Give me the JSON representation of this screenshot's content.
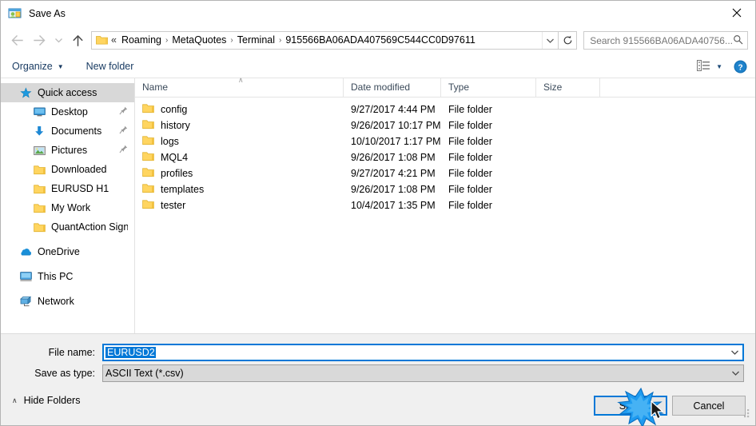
{
  "window": {
    "title": "Save As",
    "title_icon": "save-as-window-icon",
    "close_label": "✕"
  },
  "nav": {
    "back_icon": "arrow-left-icon",
    "forward_icon": "arrow-right-icon",
    "recent_icon": "chevron-down-icon",
    "up_icon": "arrow-up-icon",
    "refresh_icon": "refresh-icon",
    "address_dropdown_icon": "chevron-down-icon",
    "folder_icon": "folder-icon"
  },
  "address": {
    "leading": "«",
    "separator": "›",
    "crumbs": [
      "Roaming",
      "MetaQuotes",
      "Terminal",
      "915566BA06ADA407569C544CC0D97611"
    ]
  },
  "search": {
    "placeholder": "Search 915566BA06ADA40756...",
    "icon": "search-icon"
  },
  "commandbar": {
    "organize_label": "Organize",
    "organize_caret": "▼",
    "new_folder_label": "New folder",
    "view_icon": "view-layout-icon",
    "view_caret": "▼",
    "help_icon": "help-icon"
  },
  "sidebar": {
    "items": [
      {
        "label": "Quick access",
        "icon": "star-icon",
        "level": 0,
        "selected": true,
        "pinned": false
      },
      {
        "label": "Desktop",
        "icon": "desktop-icon",
        "level": 1,
        "selected": false,
        "pinned": true
      },
      {
        "label": "Documents",
        "icon": "documents-icon",
        "level": 1,
        "selected": false,
        "pinned": true
      },
      {
        "label": "Pictures",
        "icon": "pictures-icon",
        "level": 1,
        "selected": false,
        "pinned": true
      },
      {
        "label": "Downloaded",
        "icon": "folder-icon",
        "level": 1,
        "selected": false,
        "pinned": false
      },
      {
        "label": "EURUSD H1",
        "icon": "folder-icon",
        "level": 1,
        "selected": false,
        "pinned": false
      },
      {
        "label": "My Work",
        "icon": "folder-icon",
        "level": 1,
        "selected": false,
        "pinned": false
      },
      {
        "label": "QuantAction Signal",
        "icon": "folder-icon",
        "level": 1,
        "selected": false,
        "pinned": false
      },
      {
        "label": "OneDrive",
        "icon": "onedrive-icon",
        "level": 0,
        "selected": false,
        "pinned": false,
        "gap": true
      },
      {
        "label": "This PC",
        "icon": "thispc-icon",
        "level": 0,
        "selected": false,
        "pinned": false,
        "gap": true
      },
      {
        "label": "Network",
        "icon": "network-icon",
        "level": 0,
        "selected": false,
        "pinned": false,
        "gap": true
      }
    ]
  },
  "filelist": {
    "columns": [
      {
        "label": "Name",
        "sorted": "asc"
      },
      {
        "label": "Date modified",
        "sorted": ""
      },
      {
        "label": "Type",
        "sorted": ""
      },
      {
        "label": "Size",
        "sorted": ""
      }
    ],
    "sort_caret": "∧",
    "rows": [
      {
        "name": "config",
        "date": "9/27/2017 4:44 PM",
        "type": "File folder",
        "size": "",
        "icon": "folder-icon"
      },
      {
        "name": "history",
        "date": "9/26/2017 10:17 PM",
        "type": "File folder",
        "size": "",
        "icon": "folder-icon"
      },
      {
        "name": "logs",
        "date": "10/10/2017 1:17 PM",
        "type": "File folder",
        "size": "",
        "icon": "folder-icon"
      },
      {
        "name": "MQL4",
        "date": "9/26/2017 1:08 PM",
        "type": "File folder",
        "size": "",
        "icon": "folder-icon"
      },
      {
        "name": "profiles",
        "date": "9/27/2017 4:21 PM",
        "type": "File folder",
        "size": "",
        "icon": "folder-icon"
      },
      {
        "name": "templates",
        "date": "9/26/2017 1:08 PM",
        "type": "File folder",
        "size": "",
        "icon": "folder-icon"
      },
      {
        "name": "tester",
        "date": "10/4/2017 1:35 PM",
        "type": "File folder",
        "size": "",
        "icon": "folder-icon"
      }
    ]
  },
  "form": {
    "filename_label": "File name:",
    "filename_value": "EURUSD2",
    "filetype_label": "Save as type:",
    "filetype_value": "ASCII Text (*.csv)",
    "dropdown_icon": "chevron-down-icon"
  },
  "footer": {
    "hide_folders_label": "Hide Folders",
    "hide_folders_caret": "∧",
    "save_label": "Save",
    "cancel_label": "Cancel",
    "resize_grip_icon": "resize-grip-icon"
  },
  "colors": {
    "accent": "#0078d7",
    "folder_yellow": "#ffd04b",
    "selection_gray": "#d8d8d8",
    "panel_gray": "#f0f0f0",
    "command_text": "#1a3c63"
  },
  "pointer": {
    "click_ripple_icon": "click-ripple-icon",
    "cursor_icon": "mouse-cursor-icon"
  }
}
